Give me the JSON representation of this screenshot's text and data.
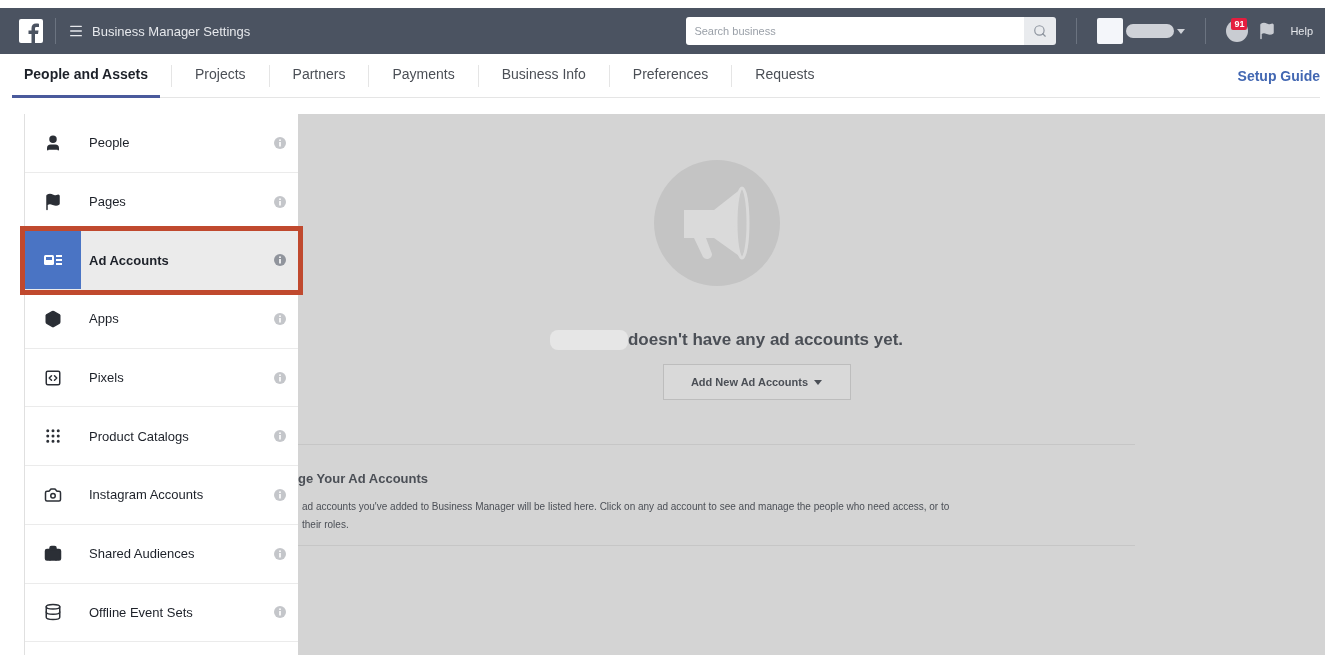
{
  "topbar": {
    "title": "Business Manager Settings",
    "search": {
      "placeholder": "Search business"
    },
    "notifications": "91",
    "help": "Help"
  },
  "tabs": [
    {
      "label": "People and Assets",
      "selected": true
    },
    {
      "label": "Projects",
      "selected": false
    },
    {
      "label": "Partners",
      "selected": false
    },
    {
      "label": "Payments",
      "selected": false
    },
    {
      "label": "Business Info",
      "selected": false
    },
    {
      "label": "Preferences",
      "selected": false
    },
    {
      "label": "Requests",
      "selected": false
    }
  ],
  "setup_guide": "Setup Guide",
  "sidebar": {
    "items": [
      {
        "label": "People",
        "selected": false,
        "annotated": false
      },
      {
        "label": "Pages",
        "selected": false,
        "annotated": false
      },
      {
        "label": "Ad Accounts",
        "selected": true,
        "annotated": true
      },
      {
        "label": "Apps",
        "selected": false,
        "annotated": false
      },
      {
        "label": "Pixels",
        "selected": false,
        "annotated": false
      },
      {
        "label": "Product Catalogs",
        "selected": false,
        "annotated": false
      },
      {
        "label": "Instagram Accounts",
        "selected": false,
        "annotated": false
      },
      {
        "label": "Shared Audiences",
        "selected": false,
        "annotated": false
      },
      {
        "label": "Offline Event Sets",
        "selected": false,
        "annotated": false
      }
    ]
  },
  "main": {
    "empty_message": "doesn't have any ad accounts yet.",
    "add_button": "Add New Ad Accounts",
    "section_heading": "ge Your Ad Accounts",
    "section_lines": [
      "ad accounts you've added to Business Manager will be listed here. Click on any ad account to see and manage the people who need access, or to",
      "their roles."
    ]
  }
}
